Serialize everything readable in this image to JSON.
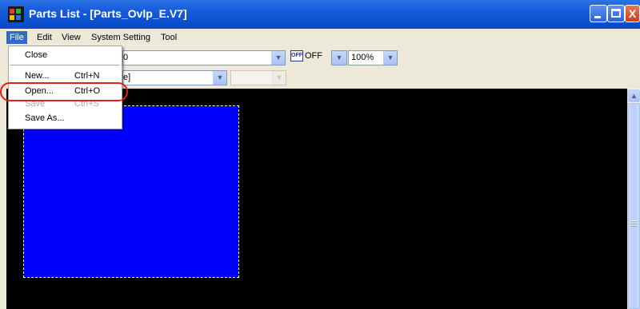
{
  "window": {
    "title": "Parts List - [Parts_Ovlp_E.V7]",
    "controls": {
      "minimize": "_",
      "maximize": "□",
      "close": "X"
    }
  },
  "menubar": {
    "items": [
      {
        "label": "File",
        "active": true
      },
      {
        "label": "Edit"
      },
      {
        "label": "View"
      },
      {
        "label": "System Setting"
      },
      {
        "label": "Tool"
      }
    ]
  },
  "toolbar1": {
    "part_select_visible_text": "0",
    "overlap_toggle": {
      "icon": "off-icon",
      "icon_text": "OFF",
      "value": "OFF"
    },
    "zoom": {
      "value": "100%"
    }
  },
  "toolbar2": {
    "layer_select_visible_text": "e]",
    "secondary_select_value": ""
  },
  "file_menu": {
    "items": [
      {
        "label": "Close",
        "shortcut": "",
        "enabled": true
      },
      {
        "label": "New...",
        "shortcut": "Ctrl+N",
        "enabled": true
      },
      {
        "label": "Open...",
        "shortcut": "Ctrl+O",
        "enabled": true,
        "highlighted": true
      },
      {
        "label": "Save",
        "shortcut": "Ctrl+S",
        "enabled": false
      },
      {
        "label": "Save As...",
        "shortcut": "",
        "enabled": true
      }
    ]
  },
  "canvas": {
    "background": "#000000",
    "part_color": "#0000ff"
  },
  "colors": {
    "title_bar": "#0a48c4",
    "menu_bg": "#ece9d8",
    "highlight_ring": "#e02020"
  }
}
